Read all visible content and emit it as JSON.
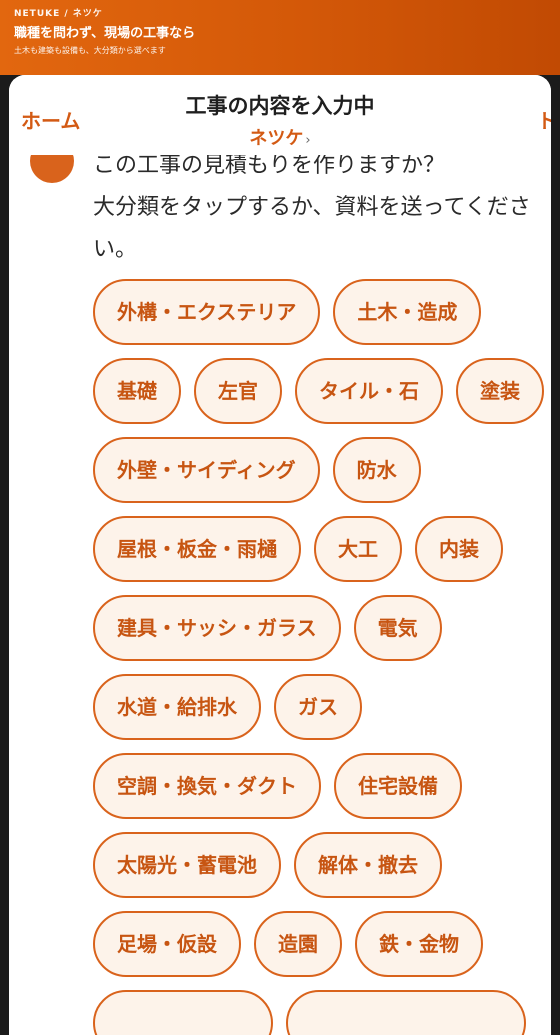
{
  "banner": {
    "brand": "NETUKE / ネツケ",
    "tagline": "職種を問わず、現場の工事なら",
    "subtagline": "土木も建築も設備も、大分類から選べます"
  },
  "header": {
    "home_label": "ホーム",
    "title": "工事の内容を入力中",
    "subtitle": "ネツケ",
    "chevron": "›",
    "right_label": "ト"
  },
  "message": {
    "text": "この工事の見積もりを作りますか？\n大分類をタップするか、資料を送ってください。"
  },
  "categories": [
    [
      "外構・エクステリア",
      "土木・造成"
    ],
    [
      "基礎",
      "左官",
      "タイル・石",
      "塗装"
    ],
    [
      "外壁・サイディング",
      "防水"
    ],
    [
      "屋根・板金・雨樋",
      "大工",
      "内装"
    ],
    [
      "建具・サッシ・ガラス",
      "電気"
    ],
    [
      "水道・給排水",
      "ガス"
    ],
    [
      "空調・換気・ダクト",
      "住宅設備"
    ],
    [
      "太陽光・蓄電池",
      "解体・撤去"
    ],
    [
      "足場・仮設",
      "造園",
      "鉄・金物"
    ],
    [
      "",
      ""
    ]
  ],
  "colors": {
    "accent": "#d9631c",
    "chip_bg": "#fdf3ea",
    "chip_text": "#c75512"
  }
}
